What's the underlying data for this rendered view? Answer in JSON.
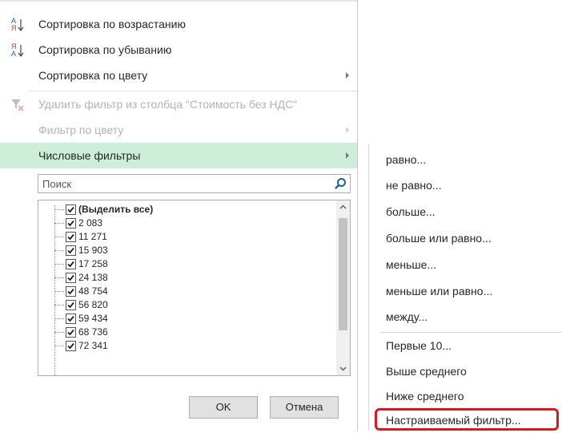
{
  "menu": {
    "sort_asc": "Сортировка по возрастанию",
    "sort_desc": "Сортировка по убыванию",
    "sort_color": "Сортировка по цвету",
    "clear_filter": "Удалить фильтр из столбца \"Стоимость без НДС\"",
    "filter_color": "Фильтр по цвету",
    "number_filters": "Числовые фильтры"
  },
  "search": {
    "placeholder": "Поиск"
  },
  "list": {
    "select_all": "(Выделить все)",
    "items": [
      "2 083",
      "11 271",
      "15 903",
      "17 258",
      "24 138",
      "48 754",
      "56 820",
      "59 434",
      "68 736",
      "72 341"
    ]
  },
  "buttons": {
    "ok": "OK",
    "cancel": "Отмена"
  },
  "submenu": {
    "items": [
      "равно...",
      "не равно...",
      "больше...",
      "больше или равно...",
      "меньше...",
      "меньше или равно...",
      "между...",
      "Первые 10...",
      "Выше среднего",
      "Ниже среднего",
      "Настраиваемый фильтр..."
    ]
  },
  "colors": {
    "highlight": "#cdeed8",
    "accent_red": "#d9181f",
    "search_icon": "#1e5fa8"
  }
}
